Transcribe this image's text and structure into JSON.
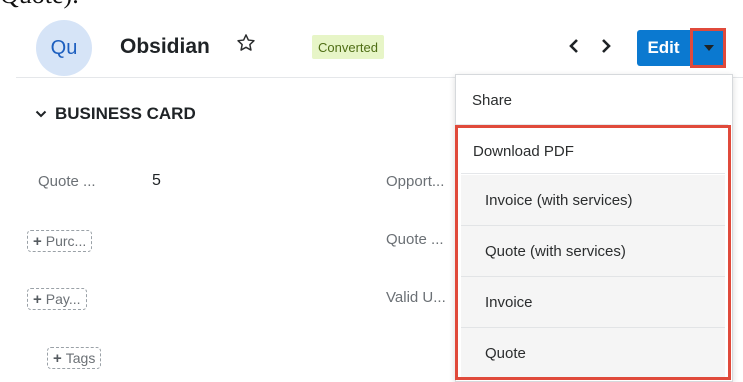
{
  "doc_fragment": "Quote).",
  "header": {
    "avatar_initials": "Qu",
    "record_name": "Obsidian",
    "status_badge": "Converted",
    "edit_label": "Edit"
  },
  "section": {
    "title": "BUSINESS CARD"
  },
  "fields": {
    "quote_label": "Quote ...",
    "quote_value": "5",
    "opport_label": "Opport...",
    "quote2_label": "Quote ...",
    "valid_label": "Valid U...",
    "purc_pill": "Purc...",
    "pay_pill": "Pay...",
    "tags_pill": "Tags"
  },
  "menu": {
    "share": "Share",
    "download_pdf": "Download PDF",
    "submenu": [
      "Invoice (with services)",
      "Quote (with services)",
      "Invoice",
      "Quote"
    ]
  },
  "colors": {
    "primary": "#0b79d0",
    "highlight": "#e04a3b",
    "badge_bg": "#e7f5c7"
  }
}
